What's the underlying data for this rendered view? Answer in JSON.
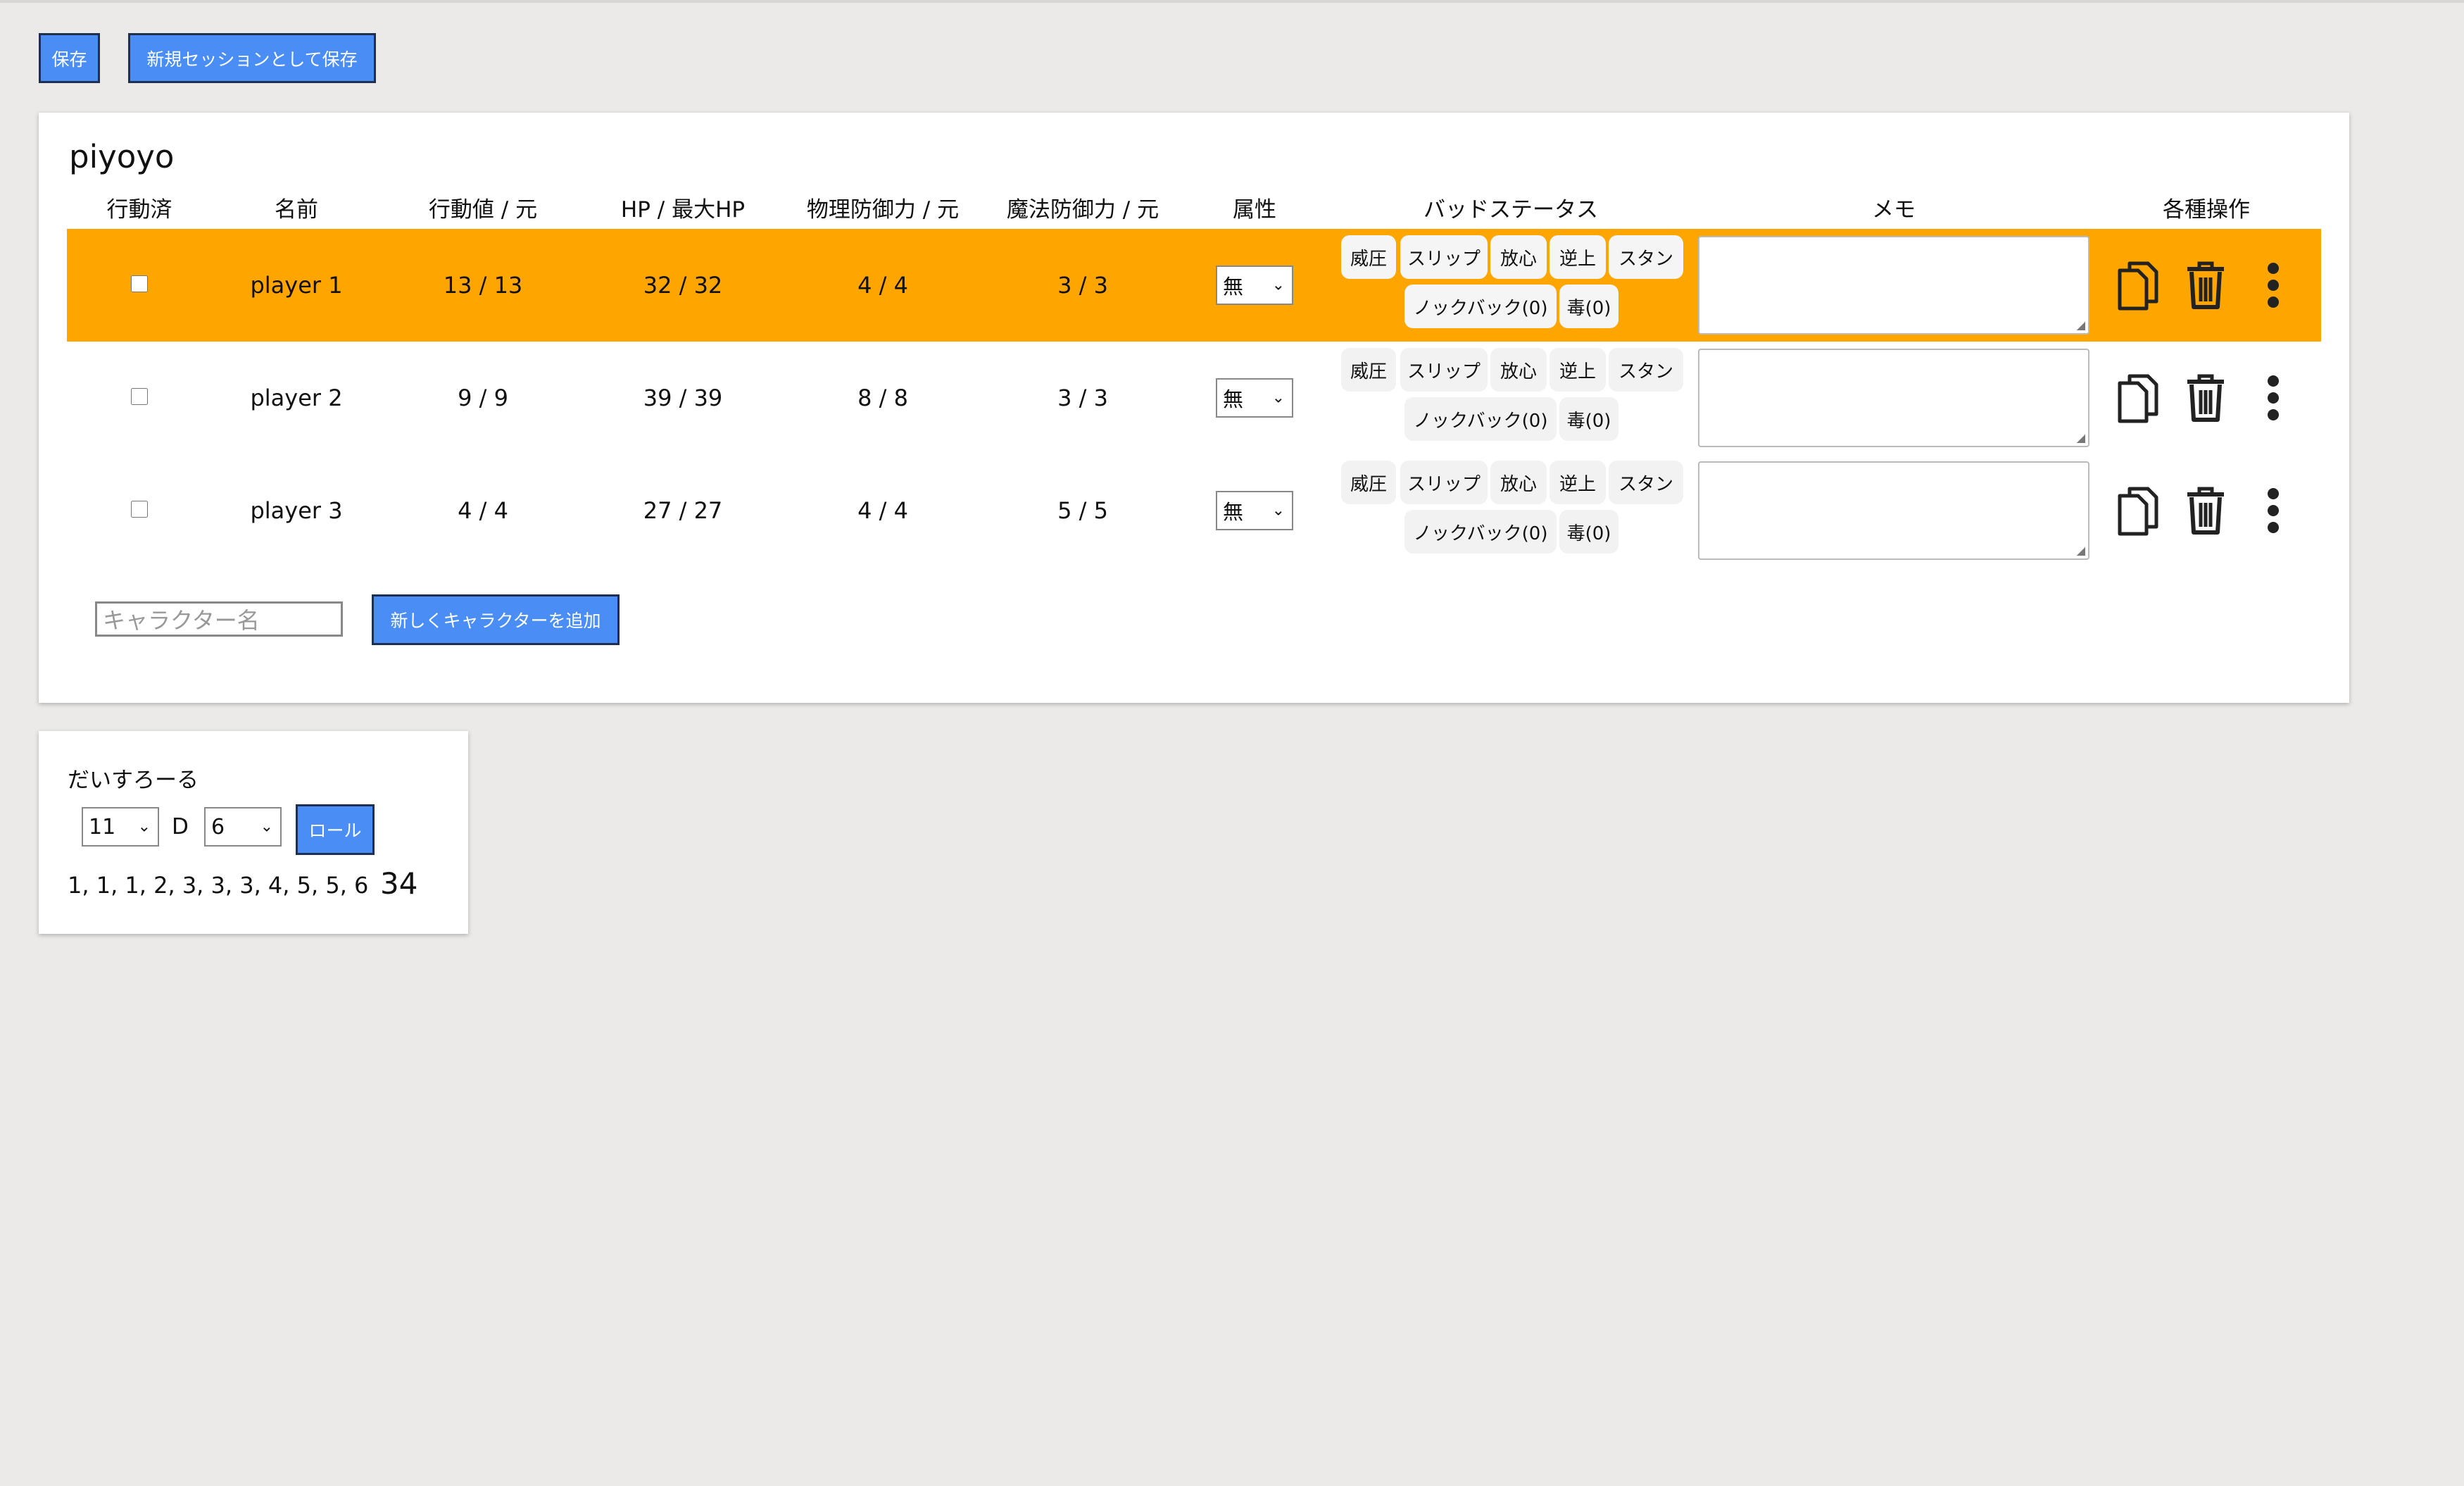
{
  "toolbar": {
    "save_label": "保存",
    "save_new_label": "新規セッションとして保存"
  },
  "session": {
    "title": "piyoyo",
    "headers": [
      "行動済",
      "名前",
      "行動値 / 元",
      "HP / 最大HP",
      "物理防御力 / 元",
      "魔法防御力 / 元",
      "属性",
      "バッドステータス",
      "メモ",
      "各種操作"
    ],
    "status_chips": [
      "威圧",
      "スリップ",
      "放心",
      "逆上",
      "スタン",
      "ノックバック(0)",
      "毒(0)"
    ],
    "characters": [
      {
        "name": "player 1",
        "action": "13 / 13",
        "hp": "32 / 32",
        "phys_def": "4 / 4",
        "mag_def": "3 / 3",
        "attribute": "無",
        "memo": "",
        "acted": false,
        "active": true
      },
      {
        "name": "player 2",
        "action": "9 / 9",
        "hp": "39 / 39",
        "phys_def": "8 / 8",
        "mag_def": "3 / 3",
        "attribute": "無",
        "memo": "",
        "acted": false,
        "active": false
      },
      {
        "name": "player 3",
        "action": "4 / 4",
        "hp": "27 / 27",
        "phys_def": "4 / 4",
        "mag_def": "5 / 5",
        "attribute": "無",
        "memo": "",
        "acted": false,
        "active": false
      }
    ],
    "add": {
      "placeholder": "キャラクター名",
      "button_label": "新しくキャラクターを追加"
    },
    "active_row_color": "#ffa500"
  },
  "dice": {
    "title": "だいすろーる",
    "count": "11",
    "separator": "D",
    "faces": "6",
    "roll_label": "ロール",
    "results": "1, 1, 1, 2, 3, 3, 3, 4, 5, 5, 6",
    "total": "34"
  },
  "colors": {
    "accent": "#4a8ef5",
    "background": "#ebeae8"
  },
  "icons": {
    "copy": "copy-icon",
    "delete": "trash-icon",
    "more": "more-vertical-icon",
    "dropdown": "chevron-down-icon"
  }
}
